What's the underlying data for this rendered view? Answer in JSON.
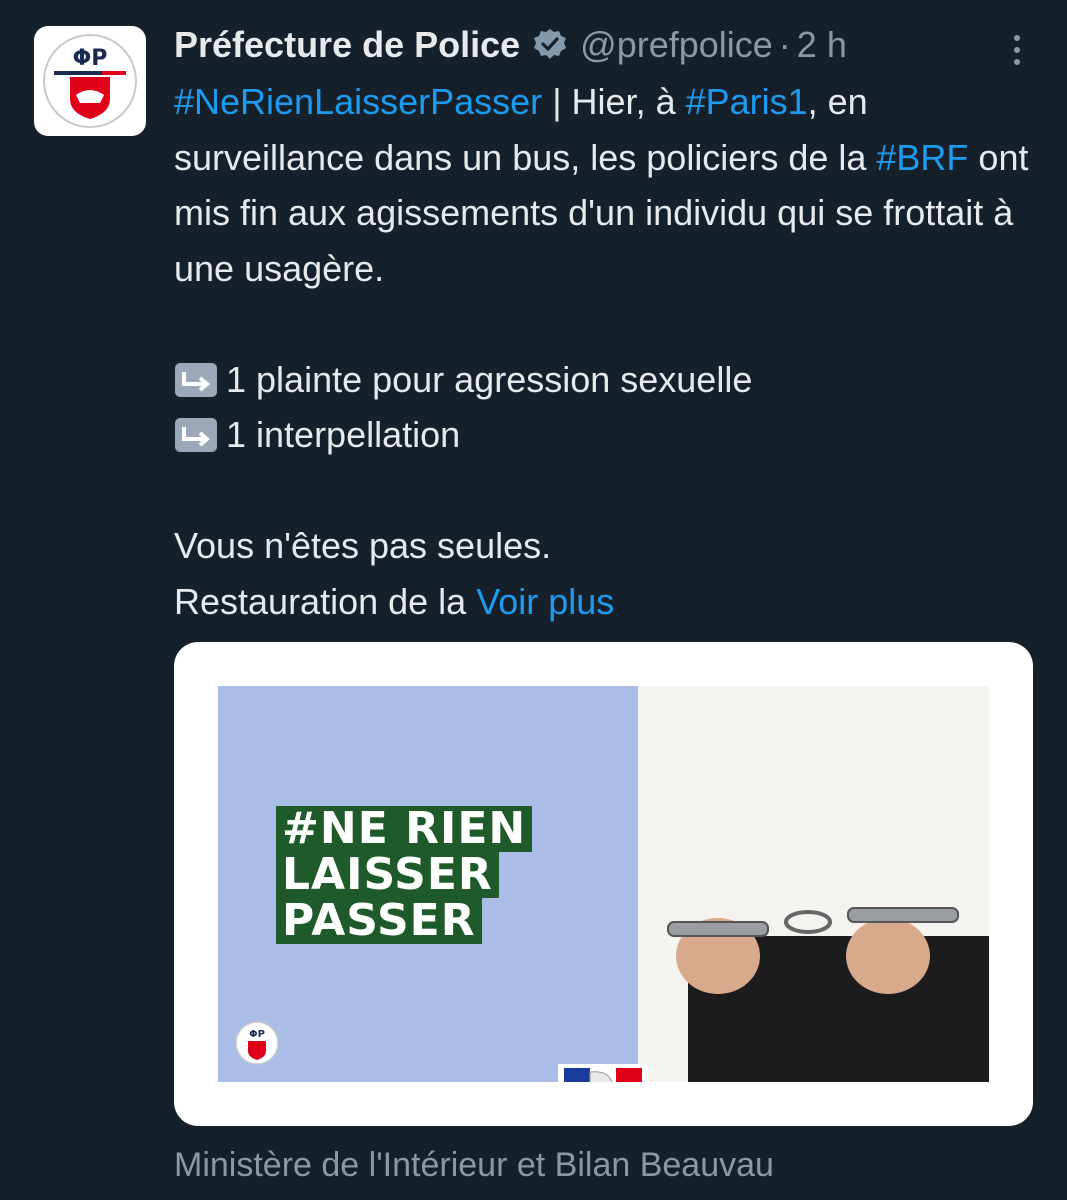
{
  "header": {
    "display_name": "Préfecture de Police",
    "handle": "@prefpolice",
    "separator": "·",
    "time": "2 h"
  },
  "icons": {
    "avatar": "prefecture-police-logo",
    "verified": "verified-badge-icon",
    "more": "more-options-icon",
    "bullet": "return-arrow-emoji-icon"
  },
  "tweet": {
    "hashtag1": "#NeRienLaisserPasser",
    "text1": " | Hier, à ",
    "hashtag2": "#Paris1",
    "text2": ", en surveillance dans un bus, les policiers de la ",
    "hashtag3": "#BRF",
    "text3": " ont mis fin aux agissements d'un individu qui se frottait à une usagère.",
    "bullet1": "1 plainte pour agression sexuelle",
    "bullet2": "1 interpellation",
    "line_seules": "Vous n'êtes pas seules.",
    "line_restauration": "Restauration de la ",
    "voir_plus": "Voir plus"
  },
  "media": {
    "slogan_lines": [
      "#NE RIEN",
      "LAISSER",
      "PASSER"
    ]
  },
  "source": "Ministère de l'Intérieur et Bilan Beauvau",
  "colors": {
    "background": "#15202b",
    "text": "#e7e9ea",
    "muted": "#8b98a5",
    "link": "#1d9bf0",
    "slogan_green": "#1f5a2a",
    "image_blue": "#a9bde6"
  }
}
